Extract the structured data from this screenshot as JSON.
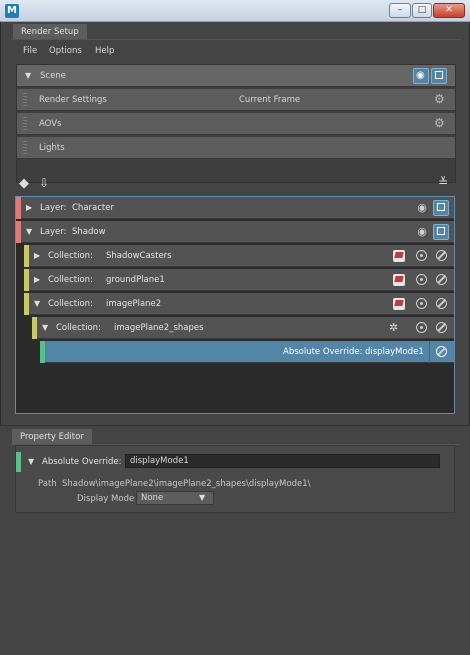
{
  "window": {
    "icon_letter": "M",
    "controls": {
      "minimize": "–",
      "maximize": "□",
      "close": "✕"
    }
  },
  "render_setup_tab": "Render Setup",
  "menu": [
    "File",
    "Options",
    "Help"
  ],
  "scene": {
    "label": "Scene",
    "items": [
      {
        "label": "Render Settings",
        "extra": "Current Frame",
        "icon": "gear-icon"
      },
      {
        "label": "AOVs",
        "icon": "gear-icon"
      },
      {
        "label": "Lights"
      }
    ]
  },
  "toolbar": {
    "left_icons": [
      "create-layer-icon",
      "import-icon"
    ],
    "right_icon": "checklist-icon"
  },
  "tree": {
    "layers": [
      {
        "prefix": "Layer:",
        "name": "Character",
        "expanded": false,
        "color": "#e17a7a"
      },
      {
        "prefix": "Layer:",
        "name": "Shadow",
        "expanded": true,
        "color": "#e17a7a"
      }
    ],
    "collections": [
      {
        "prefix": "Collection:",
        "name": "ShadowCasters",
        "expanded": false,
        "color": "#c8c86a"
      },
      {
        "prefix": "Collection:",
        "name": "groundPlane1",
        "expanded": false,
        "color": "#c8c86a"
      },
      {
        "prefix": "Collection:",
        "name": "imagePlane2",
        "expanded": true,
        "color": "#c8c86a"
      },
      {
        "prefix": "Collection:",
        "name": "imagePlane2_shapes",
        "expanded": true,
        "color": "#c8c86a"
      }
    ],
    "override": {
      "prefix": "Absolute Override:",
      "name": "displayMode1",
      "color": "#5bbf8a"
    }
  },
  "property_editor": {
    "tab": "Property Editor",
    "header_label": "Absolute Override:",
    "header_value": "displayMode1",
    "path_label": "Path",
    "path_value": "Shadow\\imagePlane2\\imagePlane2_shapes\\displayMode1\\",
    "display_mode_label": "Display Mode",
    "display_mode_value": "None"
  }
}
